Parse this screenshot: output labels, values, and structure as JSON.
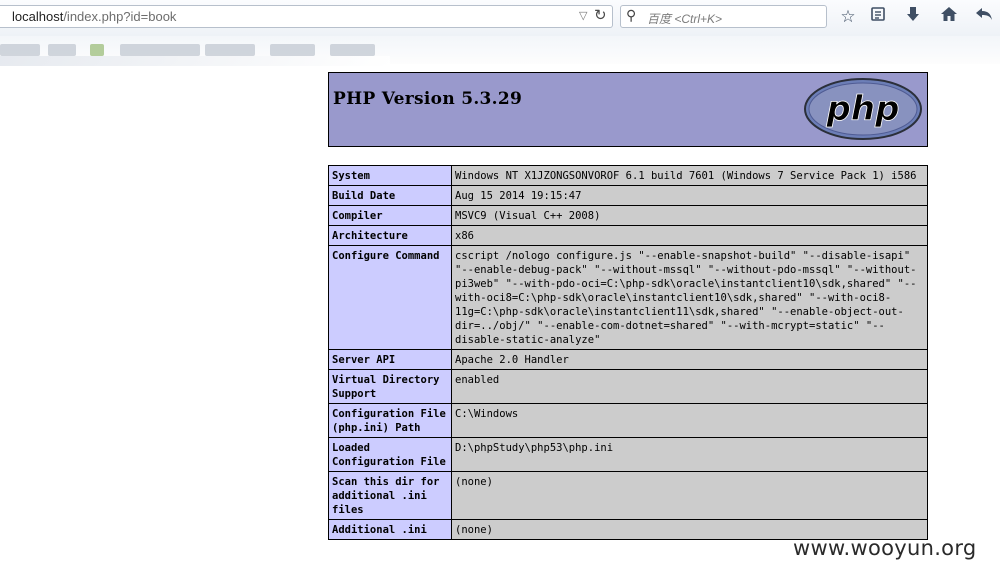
{
  "browser": {
    "url_host": "localhost",
    "url_path": "/index.php?id=book",
    "search_placeholder": "百度 <Ctrl+K>"
  },
  "phpinfo": {
    "title": "PHP Version 5.3.29",
    "logo_text": "php",
    "rows": [
      {
        "label": "System",
        "value": "Windows NT X1JZONGSONVOROF 6.1 build 7601 (Windows 7 Service Pack 1) i586"
      },
      {
        "label": "Build Date",
        "value": "Aug 15 2014 19:15:47"
      },
      {
        "label": "Compiler",
        "value": "MSVC9 (Visual C++ 2008)"
      },
      {
        "label": "Architecture",
        "value": "x86"
      },
      {
        "label": "Configure Command",
        "value": "cscript /nologo configure.js \"--enable-snapshot-build\" \"--disable-isapi\" \"--enable-debug-pack\" \"--without-mssql\" \"--without-pdo-mssql\" \"--without-pi3web\" \"--with-pdo-oci=C:\\php-sdk\\oracle\\instantclient10\\sdk,shared\" \"--with-oci8=C:\\php-sdk\\oracle\\instantclient10\\sdk,shared\" \"--with-oci8-11g=C:\\php-sdk\\oracle\\instantclient11\\sdk,shared\" \"--enable-object-out-dir=../obj/\" \"--enable-com-dotnet=shared\" \"--with-mcrypt=static\" \"--disable-static-analyze\""
      },
      {
        "label": "Server API",
        "value": "Apache 2.0 Handler"
      },
      {
        "label": "Virtual Directory Support",
        "value": "enabled"
      },
      {
        "label": "Configuration File (php.ini) Path",
        "value": "C:\\Windows"
      },
      {
        "label": "Loaded Configuration File",
        "value": "D:\\phpStudy\\php53\\php.ini"
      },
      {
        "label": "Scan this dir for additional .ini files",
        "value": "(none)"
      },
      {
        "label": "Additional .ini",
        "value": "(none)"
      }
    ]
  },
  "watermark": "www.wooyun.org"
}
